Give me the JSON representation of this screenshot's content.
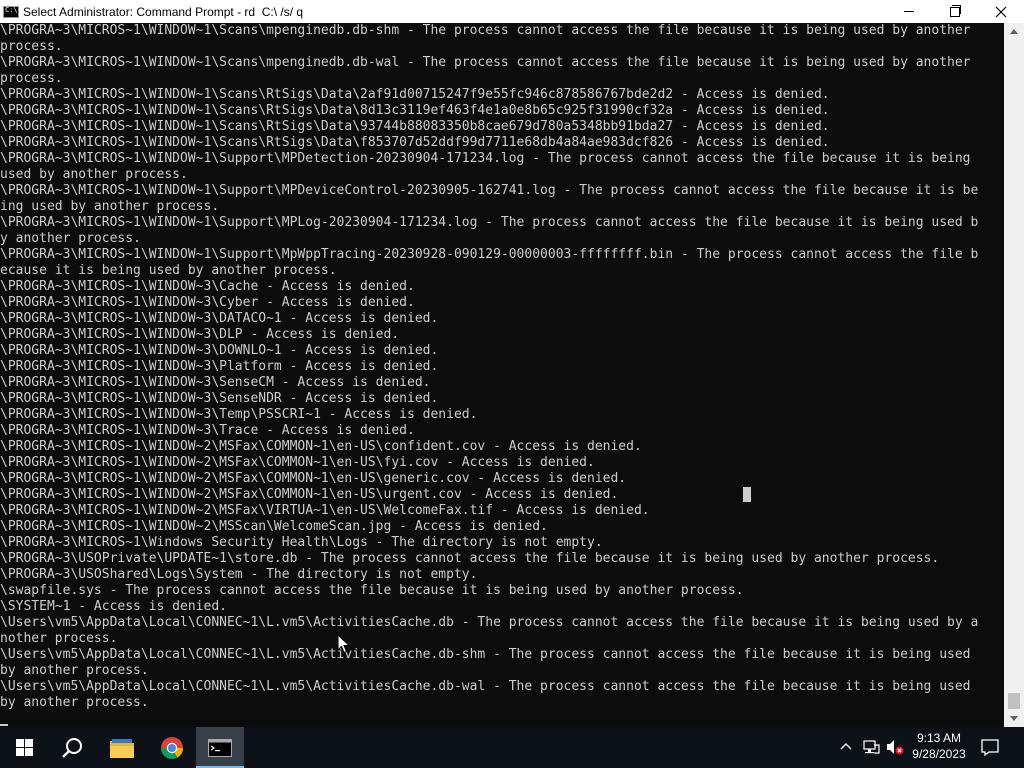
{
  "window": {
    "title": "Select Administrator: Command Prompt - rd  C:\\ /s/ q"
  },
  "console": {
    "lines": [
      "\\PROGRA~3\\MICROS~1\\WINDOW~1\\Scans\\mpenginedb.db-shm - The process cannot access the file because it is being used by another",
      "process.",
      "\\PROGRA~3\\MICROS~1\\WINDOW~1\\Scans\\mpenginedb.db-wal - The process cannot access the file because it is being used by another",
      "process.",
      "\\PROGRA~3\\MICROS~1\\WINDOW~1\\Scans\\RtSigs\\Data\\2af91d00715247f9e55fc946c878586767bde2d2 - Access is denied.",
      "\\PROGRA~3\\MICROS~1\\WINDOW~1\\Scans\\RtSigs\\Data\\8d13c3119ef463f4e1a0e8b65c925f31990cf32a - Access is denied.",
      "\\PROGRA~3\\MICROS~1\\WINDOW~1\\Scans\\RtSigs\\Data\\93744b88083350b8cae679d780a5348bb91bda27 - Access is denied.",
      "\\PROGRA~3\\MICROS~1\\WINDOW~1\\Scans\\RtSigs\\Data\\f853707d52ddf99d7711e68db4a84ae983dcf826 - Access is denied.",
      "\\PROGRA~3\\MICROS~1\\WINDOW~1\\Support\\MPDetection-20230904-171234.log - The process cannot access the file because it is being",
      "used by another process.",
      "\\PROGRA~3\\MICROS~1\\WINDOW~1\\Support\\MPDeviceControl-20230905-162741.log - The process cannot access the file because it is be",
      "ing used by another process.",
      "\\PROGRA~3\\MICROS~1\\WINDOW~1\\Support\\MPLog-20230904-171234.log - The process cannot access the file because it is being used b",
      "y another process.",
      "\\PROGRA~3\\MICROS~1\\WINDOW~1\\Support\\MpWppTracing-20230928-090129-00000003-ffffffff.bin - The process cannot access the file b",
      "ecause it is being used by another process.",
      "\\PROGRA~3\\MICROS~1\\WINDOW~3\\Cache - Access is denied.",
      "\\PROGRA~3\\MICROS~1\\WINDOW~3\\Cyber - Access is denied.",
      "\\PROGRA~3\\MICROS~1\\WINDOW~3\\DATACO~1 - Access is denied.",
      "\\PROGRA~3\\MICROS~1\\WINDOW~3\\DLP - Access is denied.",
      "\\PROGRA~3\\MICROS~1\\WINDOW~3\\DOWNLO~1 - Access is denied.",
      "\\PROGRA~3\\MICROS~1\\WINDOW~3\\Platform - Access is denied.",
      "\\PROGRA~3\\MICROS~1\\WINDOW~3\\SenseCM - Access is denied.",
      "\\PROGRA~3\\MICROS~1\\WINDOW~3\\SenseNDR - Access is denied.",
      "\\PROGRA~3\\MICROS~1\\WINDOW~3\\Temp\\PSSCRI~1 - Access is denied.",
      "\\PROGRA~3\\MICROS~1\\WINDOW~3\\Trace - Access is denied.",
      "\\PROGRA~3\\MICROS~1\\WINDOW~2\\MSFax\\COMMON~1\\en-US\\confident.cov - Access is denied.",
      "\\PROGRA~3\\MICROS~1\\WINDOW~2\\MSFax\\COMMON~1\\en-US\\fyi.cov - Access is denied.",
      "\\PROGRA~3\\MICROS~1\\WINDOW~2\\MSFax\\COMMON~1\\en-US\\generic.cov - Access is denied.",
      "\\PROGRA~3\\MICROS~1\\WINDOW~2\\MSFax\\COMMON~1\\en-US\\urgent.cov - Access is denied.",
      "\\PROGRA~3\\MICROS~1\\WINDOW~2\\MSFax\\VIRTUA~1\\en-US\\WelcomeFax.tif - Access is denied.",
      "\\PROGRA~3\\MICROS~1\\WINDOW~2\\MSScan\\WelcomeScan.jpg - Access is denied.",
      "\\PROGRA~3\\MICROS~1\\Windows Security Health\\Logs - The directory is not empty.",
      "\\PROGRA~3\\USOPrivate\\UPDATE~1\\store.db - The process cannot access the file because it is being used by another process.",
      "\\PROGRA~3\\USOShared\\Logs\\System - The directory is not empty.",
      "\\swapfile.sys - The process cannot access the file because it is being used by another process.",
      "\\SYSTEM~1 - Access is denied.",
      "\\Users\\vm5\\AppData\\Local\\CONNEC~1\\L.vm5\\ActivitiesCache.db - The process cannot access the file because it is being used by a",
      "nother process.",
      "\\Users\\vm5\\AppData\\Local\\CONNEC~1\\L.vm5\\ActivitiesCache.db-shm - The process cannot access the file because it is being used",
      "by another process.",
      "\\Users\\vm5\\AppData\\Local\\CONNEC~1\\L.vm5\\ActivitiesCache.db-wal - The process cannot access the file because it is being used",
      "by another process."
    ]
  },
  "taskbar": {
    "items": [
      "windows-start-icon",
      "search-icon",
      "file-explorer-icon",
      "chrome-icon",
      "command-prompt-icon"
    ],
    "clock": {
      "time": "9:13 AM",
      "date": "9/28/2023"
    }
  },
  "colors": {
    "console_bg": "#0c0c0c",
    "console_text": "#cccccc",
    "taskbar_bg": "#0d1218",
    "accent": "#76b9ed"
  }
}
